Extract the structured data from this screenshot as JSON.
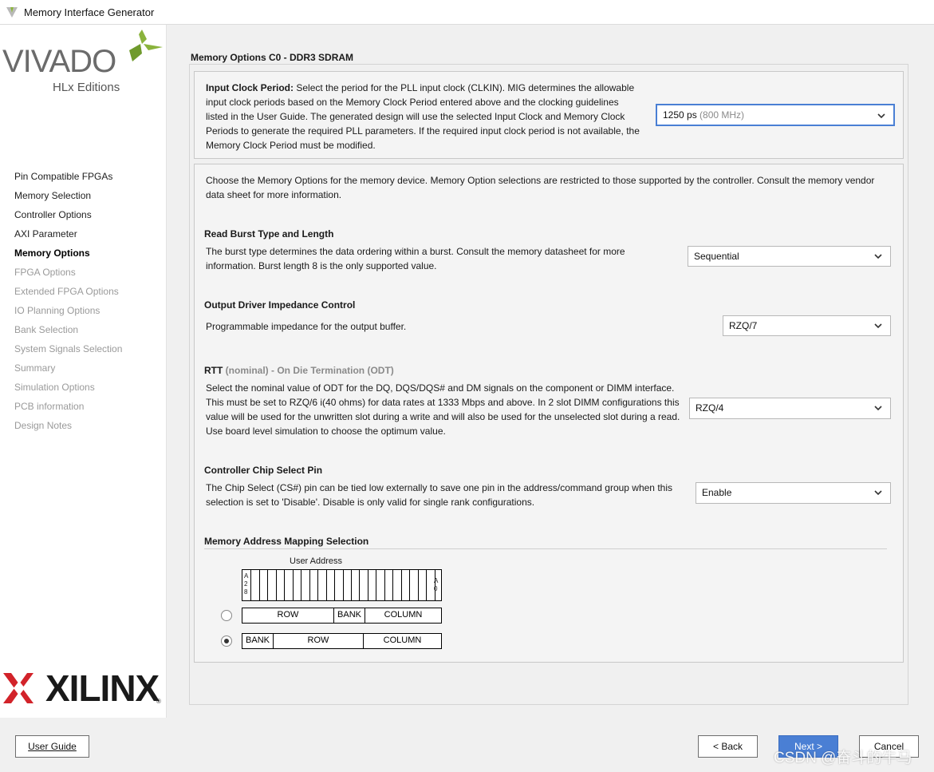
{
  "window": {
    "title": "Memory Interface Generator"
  },
  "brand": {
    "vivado": "VIVADO",
    "hlx": "HLx Editions",
    "xilinx": "XILINX"
  },
  "nav": [
    {
      "label": "Pin Compatible FPGAs",
      "state": "normal"
    },
    {
      "label": "Memory Selection",
      "state": "normal"
    },
    {
      "label": "Controller Options",
      "state": "normal"
    },
    {
      "label": "AXI Parameter",
      "state": "normal"
    },
    {
      "label": "Memory Options",
      "state": "selected"
    },
    {
      "label": "FPGA Options",
      "state": "disabled"
    },
    {
      "label": "Extended FPGA Options",
      "state": "disabled"
    },
    {
      "label": "IO Planning Options",
      "state": "disabled"
    },
    {
      "label": "Bank Selection",
      "state": "disabled"
    },
    {
      "label": "System Signals Selection",
      "state": "disabled"
    },
    {
      "label": "Summary",
      "state": "disabled"
    },
    {
      "label": "Simulation Options",
      "state": "disabled"
    },
    {
      "label": "PCB information",
      "state": "disabled"
    },
    {
      "label": "Design Notes",
      "state": "disabled"
    }
  ],
  "main": {
    "heading": "Memory Options C0 - DDR3 SDRAM",
    "clock": {
      "label": "Input Clock Period:",
      "desc": "Select the period for the PLL input clock (CLKIN). MIG determines the allowable input clock periods based on the Memory Clock Period entered above and the clocking guidelines listed in the User Guide. The generated design will use the selected Input Clock and Memory Clock Periods to generate the required PLL parameters. If the required input clock period is not available, the Memory Clock Period must be modified.",
      "value": "1250 ps",
      "value_hint": "(800 MHz)"
    },
    "intro": "Choose the Memory Options for the memory device. Memory Option selections are restricted to those supported by the controller. Consult the memory vendor data sheet for more information.",
    "burst": {
      "title": "Read Burst Type and Length",
      "desc": "The burst type determines the data ordering within a burst. Consult the memory datasheet for more information. Burst length 8 is the only supported value.",
      "value": "Sequential"
    },
    "odic": {
      "title": "Output Driver Impedance Control",
      "desc": "Programmable impedance for the output buffer.",
      "value": "RZQ/7"
    },
    "rtt": {
      "title": "RTT",
      "title_suffix": "(nominal) - On Die Termination (ODT)",
      "desc": "Select the nominal value of ODT for the DQ, DQS/DQS# and DM signals on the component or DIMM interface. This must be set to RZQ/6 i(40 ohms) for data rates at 1333 Mbps and above. In 2 slot DIMM configurations this value will be used for the unwritten slot during a write and will also be used for the unselected slot during a read. Use board level simulation to choose the optimum value.",
      "value": "RZQ/4"
    },
    "cs": {
      "title": "Controller Chip Select Pin",
      "desc": "The Chip Select (CS#) pin can be tied low externally to save one pin in the address/command group when this selection is set to 'Disable'. Disable is only valid for single rank configurations.",
      "value": "Enable"
    },
    "mapping": {
      "title": "Memory Address Mapping Selection",
      "user_address": "User Address",
      "msb": [
        "A",
        "2",
        "8"
      ],
      "lsb": [
        "A",
        "0"
      ],
      "option1": {
        "parts": [
          "ROW",
          "BANK",
          "COLUMN"
        ],
        "selected": false
      },
      "option2": {
        "parts": [
          "BANK",
          "ROW",
          "COLUMN"
        ],
        "selected": true
      }
    }
  },
  "footer": {
    "user_guide": "User Guide",
    "back": "< Back",
    "next": "Next >",
    "cancel": "Cancel",
    "watermark": "CSDN @奋斗的牛马"
  },
  "colors": {
    "accent": "#4a7fd4",
    "logo_green": "#8ab33c",
    "xilinx_red": "#d2232a"
  }
}
